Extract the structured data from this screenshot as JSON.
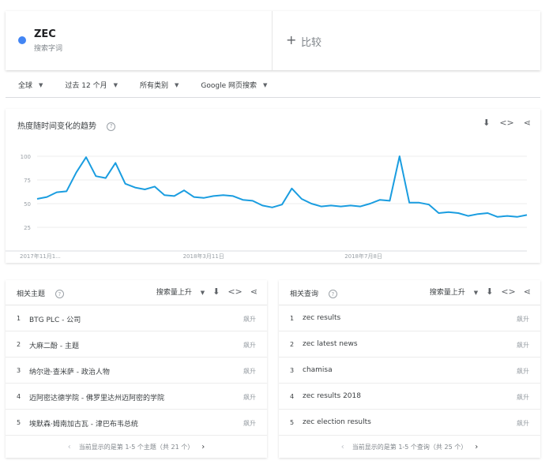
{
  "term": {
    "name": "ZEC",
    "subtitle": "搜索字词",
    "dot_color": "#4285f4"
  },
  "compare": {
    "plus": "+",
    "label": "比较"
  },
  "filters": [
    {
      "label": "全球"
    },
    {
      "label": "过去 12 个月"
    },
    {
      "label": "所有类别"
    },
    {
      "label": "Google 网页搜索"
    }
  ],
  "interest": {
    "title": "热度随时间变化的趋势",
    "help": "?"
  },
  "chart_data": {
    "type": "line",
    "title": "",
    "xlabel": "",
    "ylabel": "",
    "ylim": [
      0,
      100
    ],
    "y_ticks": [
      25,
      50,
      75,
      100
    ],
    "x_tick_labels": [
      "2017年11月1...",
      "2018年3月11日",
      "2018年7月8日"
    ],
    "grid": true,
    "color": "#1a9de0",
    "series": [
      {
        "name": "",
        "values": [
          55,
          57,
          62,
          63,
          83,
          99,
          79,
          77,
          93,
          71,
          67,
          65,
          68,
          59,
          58,
          64,
          57,
          56,
          58,
          59,
          58,
          54,
          53,
          48,
          46,
          49,
          66,
          55,
          50,
          47,
          48,
          47,
          48,
          47,
          50,
          54,
          53,
          100,
          51,
          51,
          49,
          40,
          41,
          40,
          37,
          39,
          40,
          36,
          37,
          36,
          38
        ]
      }
    ]
  },
  "topics": {
    "title": "相关主题",
    "sort_label": "搜索量上升",
    "rows": [
      {
        "num": "1",
        "label": "BTG PLC - 公司",
        "value": "飙升"
      },
      {
        "num": "2",
        "label": "大麻二酚 - 主题",
        "value": "飙升"
      },
      {
        "num": "3",
        "label": "纳尔逊·查米萨 - 政治人物",
        "value": "飙升"
      },
      {
        "num": "4",
        "label": "迈阿密达德学院 - 佛罗里达州迈阿密的学院",
        "value": "飙升"
      },
      {
        "num": "5",
        "label": "埃默森·姆南加古瓦 - 津巴布韦总统",
        "value": "飙升"
      }
    ],
    "pager": "当前显示的是第 1-5 个主题（共 21 个）"
  },
  "queries": {
    "title": "相关查询",
    "sort_label": "搜索量上升",
    "rows": [
      {
        "num": "1",
        "label": "zec results",
        "value": "飙升"
      },
      {
        "num": "2",
        "label": "zec latest news",
        "value": "飙升"
      },
      {
        "num": "3",
        "label": "chamisa",
        "value": "飙升"
      },
      {
        "num": "4",
        "label": "zec results 2018",
        "value": "飙升"
      },
      {
        "num": "5",
        "label": "zec election results",
        "value": "飙升"
      }
    ],
    "pager": "当前显示的是第 1-5 个查询（共 25 个）"
  },
  "icons": {
    "download": "⬇",
    "embed": "<>",
    "share": "⋖",
    "caret": "▼",
    "prev": "‹",
    "next": "›"
  }
}
